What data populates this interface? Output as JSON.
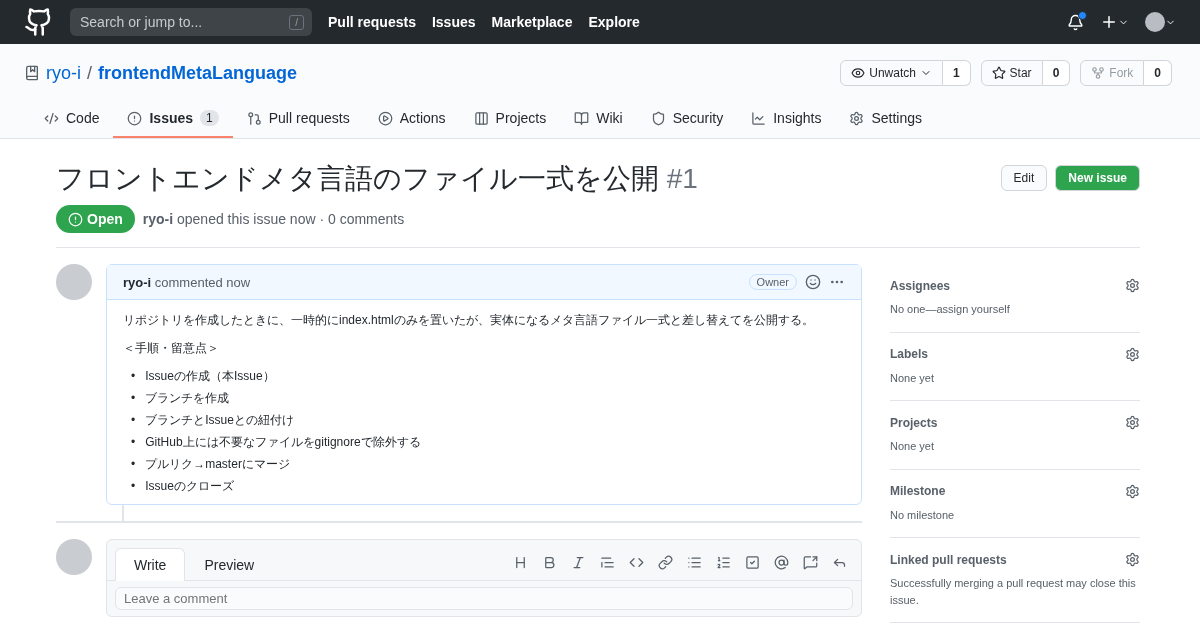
{
  "header": {
    "search": {
      "placeholder": "Search or jump to...",
      "key": "/"
    },
    "nav": [
      "Pull requests",
      "Issues",
      "Marketplace",
      "Explore"
    ],
    "notification_unread": true
  },
  "repo": {
    "owner": "ryo-i",
    "separator": "/",
    "name": "frontendMetaLanguage",
    "actions": [
      {
        "label": "Unwatch",
        "count": "1",
        "disabled": false,
        "menu": true
      },
      {
        "label": "Star",
        "count": "0",
        "disabled": false,
        "menu": false
      },
      {
        "label": "Fork",
        "count": "0",
        "disabled": true,
        "menu": false
      }
    ]
  },
  "tabs": [
    {
      "label": "Code",
      "selected": false
    },
    {
      "label": "Issues",
      "count": "1",
      "selected": true
    },
    {
      "label": "Pull requests",
      "selected": false
    },
    {
      "label": "Actions",
      "selected": false
    },
    {
      "label": "Projects",
      "selected": false
    },
    {
      "label": "Wiki",
      "selected": false
    },
    {
      "label": "Security",
      "selected": false
    },
    {
      "label": "Insights",
      "selected": false
    },
    {
      "label": "Settings",
      "selected": false
    }
  ],
  "issue": {
    "title": "フロントエンドメタ言語のファイル一式を公開",
    "number": "#1",
    "buttons": [
      "Edit",
      "New issue"
    ],
    "state": "Open",
    "author": "ryo-i",
    "meta": "opened this issue now · 0 comments"
  },
  "comment": {
    "author": "ryo-i",
    "action": "commented now",
    "badge": "Owner",
    "paragraphs": [
      "リポジトリを作成したときに、一時的にindex.htmlのみを置いたが、実体になるメタ言語ファイル一式と差し替えてを公開する。",
      "＜手順・留意点＞"
    ],
    "items": [
      {
        "bullet": "•",
        "text": "Issueの作成（本Issue）"
      },
      {
        "bullet": "•",
        "text": "ブランチを作成"
      },
      {
        "bullet": "•",
        "text": "ブランチとIssueとの紐付け"
      },
      {
        "bullet": "•",
        "text": "GitHub上には不要なファイルをgitignoreで除外する"
      },
      {
        "bullet": "•",
        "text": "プルリク→masterにマージ"
      },
      {
        "bullet": "•",
        "text": "Issueのクローズ"
      }
    ]
  },
  "editor": {
    "tabs": [
      {
        "label": "Write",
        "selected": true
      },
      {
        "label": "Preview",
        "selected": false
      }
    ],
    "placeholder": "Leave a comment"
  },
  "sidebar": [
    {
      "heading": "Assignees",
      "value": "No one—assign yourself"
    },
    {
      "heading": "Labels",
      "value": "None yet"
    },
    {
      "heading": "Projects",
      "value": "None yet"
    },
    {
      "heading": "Milestone",
      "value": "No milestone"
    },
    {
      "heading": "Linked pull requests",
      "value": "Successfully merging a pull request may close this issue."
    }
  ]
}
